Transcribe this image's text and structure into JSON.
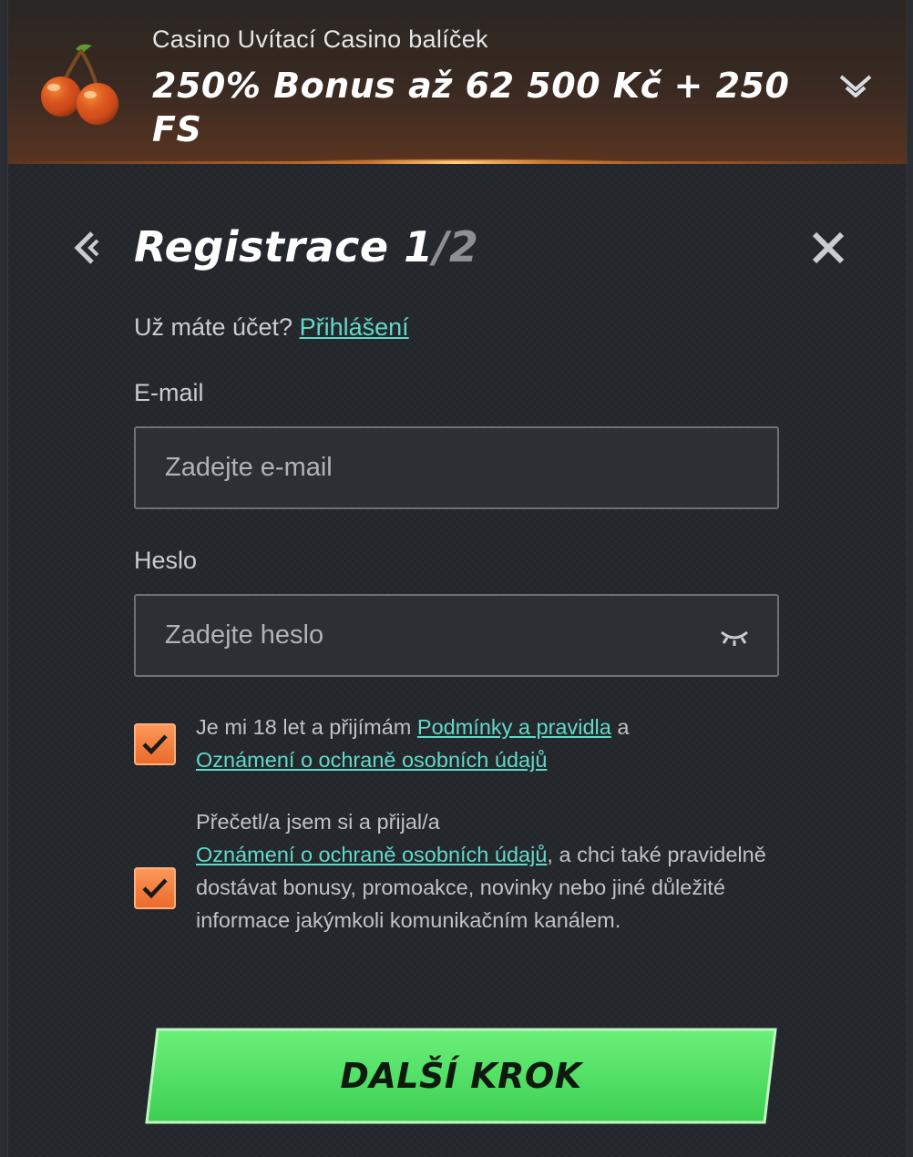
{
  "banner": {
    "subtitle": "Casino Uvítací Casino balíček",
    "title": "250% Bonus až 62 500 Kč + 250 FS",
    "icon": "cherry-icon",
    "toggle_icon": "chevron-down-icon"
  },
  "form": {
    "title": "Registrace",
    "step_current": "1",
    "step_total": "/2",
    "back_icon": "chevron-left-icon",
    "close_icon": "close-icon",
    "login_prompt": "Už máte účet?",
    "login_link": "Přihlášení"
  },
  "email": {
    "label": "E-mail",
    "placeholder": "Zadejte e-mail",
    "value": ""
  },
  "password": {
    "label": "Heslo",
    "placeholder": "Zadejte heslo",
    "value": "",
    "toggle_icon": "eye-closed-icon"
  },
  "consent_terms": {
    "checked": true,
    "text_before": "Je mi 18 let a přijímám ",
    "link1": "Podmínky a pravidla",
    "text_mid": " a ",
    "link2": "Oznámení o ochraně osobních údajů"
  },
  "consent_marketing": {
    "checked": true,
    "text_before": "Přečetl/a jsem si a přijal/a ",
    "link": "Oznámení o ochraně osobních údajů",
    "text_after": ", a chci také pravidelně dostávat bonusy, promoakce, novinky nebo jiné důležité informace jakýmkoli komunikačním kanálem."
  },
  "next_button": {
    "label": "DALŠÍ KROK"
  },
  "colors": {
    "accent_link": "#62d9c8",
    "checkbox": "#f07a38",
    "button": "#4cdc5e",
    "background": "#23262b"
  }
}
